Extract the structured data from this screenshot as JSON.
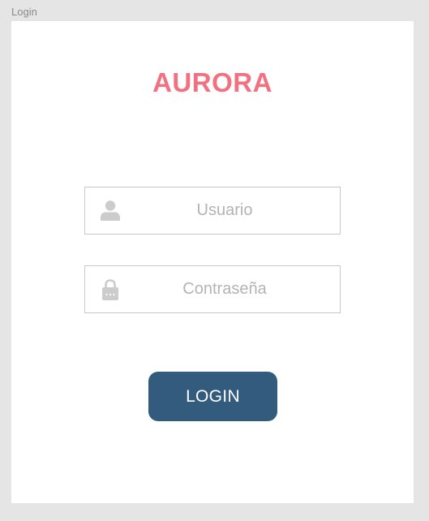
{
  "frame": {
    "label": "Login"
  },
  "brand": {
    "name": "AURORA",
    "color": "#f2707f"
  },
  "username_field": {
    "placeholder": "Usuario",
    "value": "",
    "icon": "user-icon"
  },
  "password_field": {
    "placeholder": "Contraseña",
    "value": "",
    "icon": "lock-icon"
  },
  "login_button": {
    "label": "LOGIN",
    "color": "#335b7e"
  },
  "colors": {
    "background": "#e5e5e5",
    "card": "#ffffff",
    "field_border": "#c7c7c7",
    "icon": "#cccccc",
    "placeholder": "#b3b3b3"
  }
}
